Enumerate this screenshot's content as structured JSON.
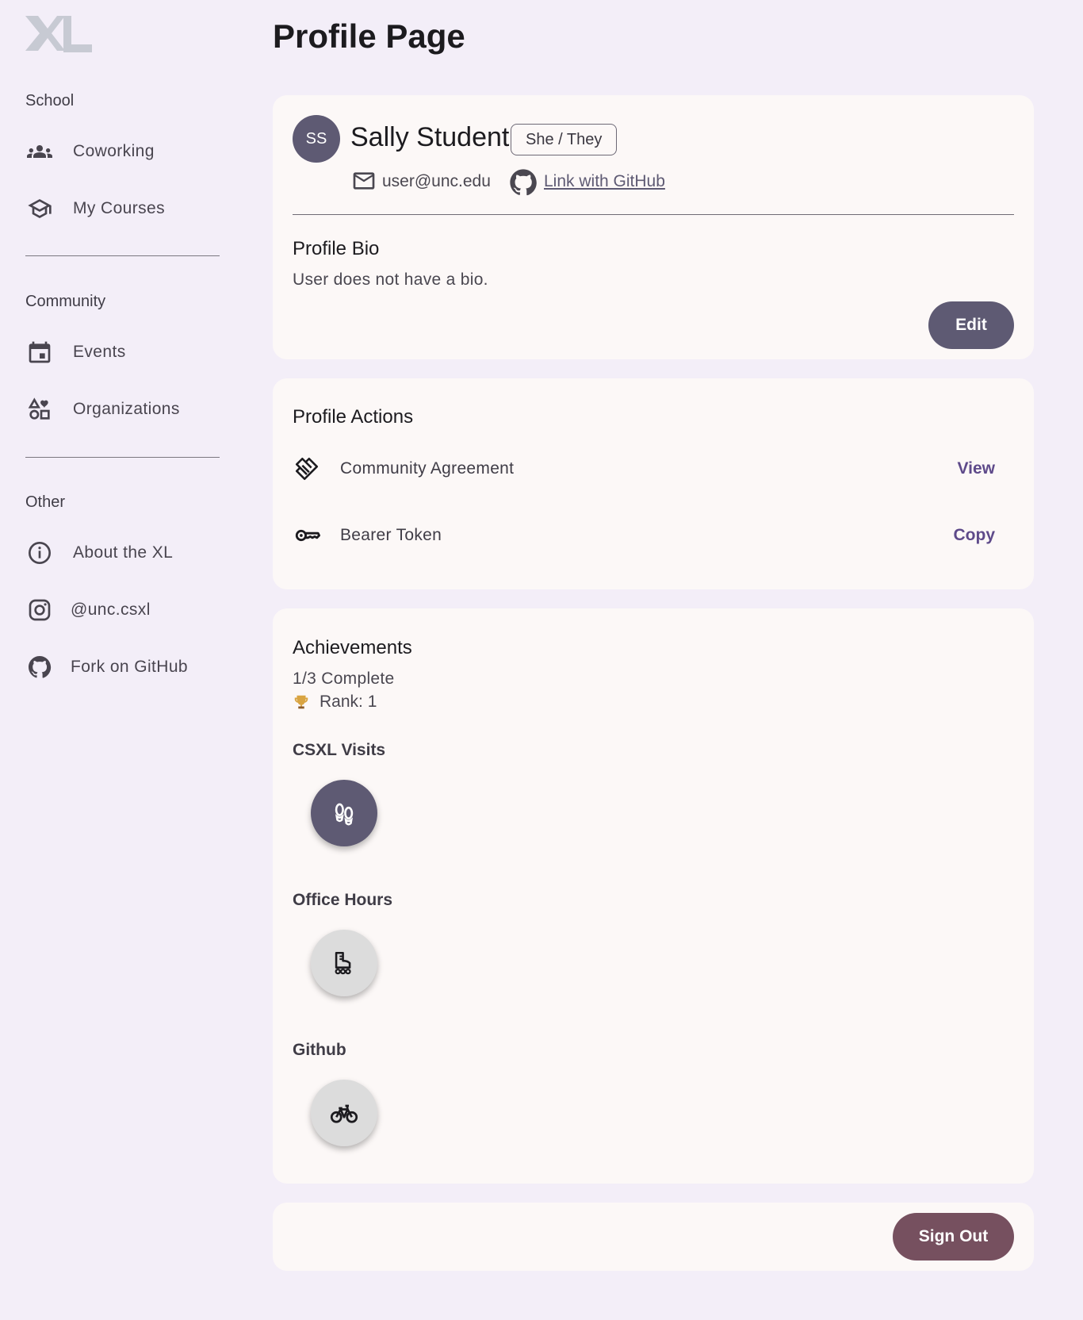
{
  "sidebar": {
    "sections": {
      "school": "School",
      "community": "Community",
      "other": "Other"
    },
    "items": {
      "coworking": {
        "label": "Coworking",
        "icon": "group-icon"
      },
      "courses": {
        "label": "My Courses",
        "icon": "graduation-cap-icon"
      },
      "events": {
        "label": "Events",
        "icon": "calendar-icon"
      },
      "organizations": {
        "label": "Organizations",
        "icon": "category-icon"
      },
      "about": {
        "label": "About the XL",
        "icon": "info-icon"
      },
      "instagram": {
        "label": "@unc.csxl",
        "icon": "instagram-icon"
      },
      "github": {
        "label": "Fork on GitHub",
        "icon": "github-icon"
      }
    }
  },
  "page": {
    "title": "Profile Page"
  },
  "profile": {
    "initials": "SS",
    "name": "Sally Student",
    "pronouns": "She / They",
    "email": "user@unc.edu",
    "github_link": "Link with GitHub",
    "bio_heading": "Profile Bio",
    "bio_text": "User does not have a bio.",
    "edit_label": "Edit"
  },
  "actions": {
    "heading": "Profile Actions",
    "rows": [
      {
        "label": "Community Agreement",
        "link": "View",
        "icon": "handshake-icon"
      },
      {
        "label": "Bearer Token",
        "link": "Copy",
        "icon": "key-icon"
      }
    ]
  },
  "achievements": {
    "heading": "Achievements",
    "progress": "1/3 Complete",
    "rank": "Rank: 1",
    "items": [
      {
        "title": "CSXL Visits",
        "icon": "footprints-icon",
        "earned": true
      },
      {
        "title": "Office Hours",
        "icon": "roller-skate-icon",
        "earned": false
      },
      {
        "title": "Github",
        "icon": "bike-icon",
        "earned": false
      }
    ]
  },
  "signout": {
    "label": "Sign Out"
  },
  "colors": {
    "background": "#f3eef8",
    "card": "#fcf8f7",
    "primary": "#5e5a73",
    "signout": "#76505f",
    "link": "#5e4a8a"
  }
}
